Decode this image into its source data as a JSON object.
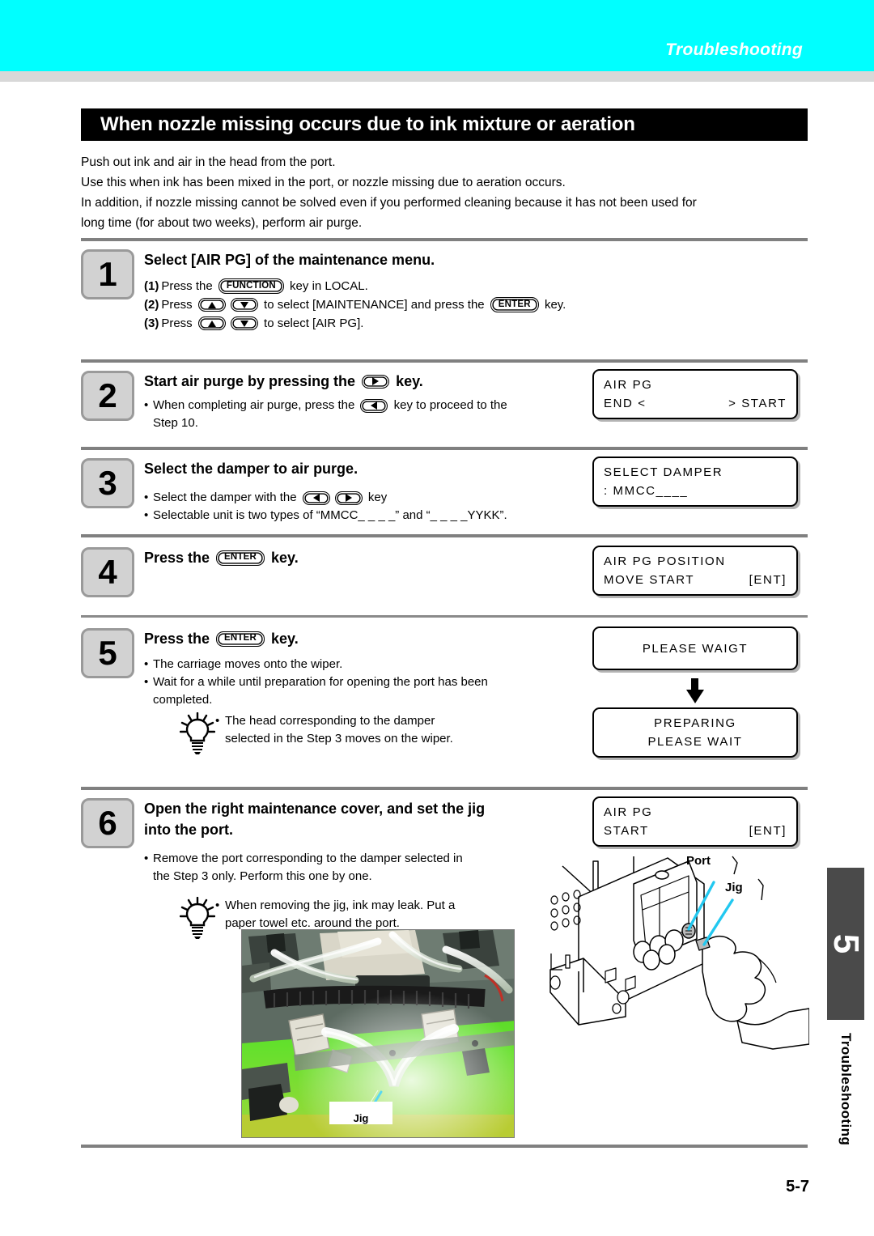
{
  "banner": {
    "chapter_label": "Troubleshooting",
    "color": "#00ffff"
  },
  "section": {
    "title": "When nozzle missing occurs due to ink mixture or aeration"
  },
  "intro": {
    "line1": "Push out ink and air in the head from the port.",
    "line2": "Use this when ink has been mixed in the port, or nozzle missing due to aeration occurs.",
    "line3": "In addition, if nozzle missing cannot be solved even if you performed cleaning because it has not been used for",
    "line4": "long time (for about two weeks), perform air purge."
  },
  "steps": {
    "s1": {
      "number": "1",
      "heading": "Select [AIR PG] of the maintenance menu.",
      "items": [
        {
          "n": "(1)",
          "a": "Press the ",
          "key": "FUNCTION",
          "b": " key in LOCAL."
        },
        {
          "n": "(2)",
          "a": "Press ",
          "b": " to select [MAINTENANCE] and press the ",
          "key2": "ENTER",
          "c": " key."
        },
        {
          "n": "(3)",
          "a": "Press ",
          "b": " to select [AIR PG]."
        }
      ]
    },
    "s2": {
      "number": "2",
      "heading_a": "Start air purge by pressing the ",
      "heading_b": " key.",
      "bullet_a": "When completing air purge, press the ",
      "bullet_b": " key to proceed to the",
      "bullet_c": "Step 10.",
      "lcd": {
        "line1": "AIR PG",
        "line2_left": "END <",
        "line2_right": "> START"
      }
    },
    "s3": {
      "number": "3",
      "heading": "Select the damper to air purge.",
      "bullet1_a": "Select the damper with the ",
      "bullet1_b": " key",
      "bullet2": "Selectable unit is two types of “MMCC_ _ _ _” and “_ _ _ _YYKK”.",
      "lcd": {
        "line1": "SELECT DAMPER",
        "line2": ": MMCC____"
      }
    },
    "s4": {
      "number": "4",
      "heading_a": "Press the ",
      "heading_key": "ENTER",
      "heading_b": " key.",
      "lcd": {
        "line1": "AIR PG POSITION",
        "line2_left": "MOVE START",
        "line2_right": "[ENT]"
      }
    },
    "s5": {
      "number": "5",
      "heading_a": "Press the ",
      "heading_key": "ENTER",
      "heading_b": " key.",
      "bullet1": "The carriage moves onto the wiper.",
      "bullet2_a": "Wait for a while until preparation for opening the port has been",
      "bullet2_b": "completed.",
      "tip_a": "The head corresponding to the damper",
      "tip_b": "selected in the Step 3 moves on the wiper.",
      "lcd1": {
        "line1": "PLEASE WAIGT"
      },
      "lcd2": {
        "line1": "PREPARING",
        "line2": "PLEASE WAIT"
      }
    },
    "s6": {
      "number": "6",
      "heading_l1": "Open the right maintenance cover, and set the jig",
      "heading_l2": "into the port.",
      "bullet_a": "Remove the port corresponding to the damper selected in",
      "bullet_b": "the Step 3 only. Perform this one by one.",
      "tip_a": "When removing the jig, ink may leak. Put a",
      "tip_b": "paper towel etc. around the port.",
      "lcd": {
        "line1": "AIR PG",
        "line2_left": "START",
        "line2_right": "[ENT]"
      },
      "illustration_labels": {
        "port": "Port",
        "jig": "Jig"
      },
      "photo_label": "Jig"
    }
  },
  "side_tab": {
    "chapter_number": "5",
    "chapter_name": "Troubleshooting"
  },
  "footer": {
    "page_number": "5-7"
  }
}
